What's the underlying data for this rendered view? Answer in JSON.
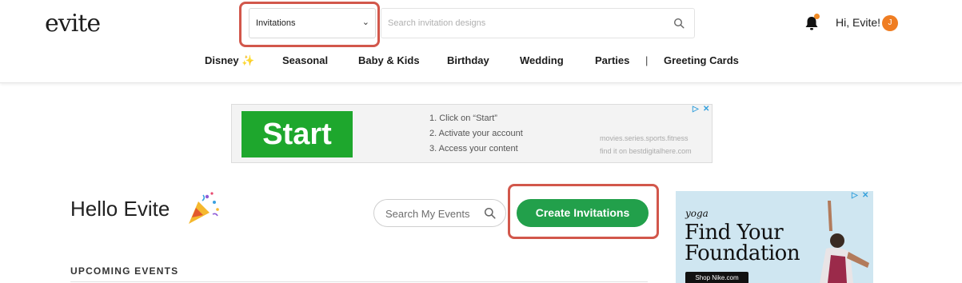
{
  "header": {
    "logo": "evite",
    "category_select": {
      "value": "Invitations"
    },
    "search": {
      "placeholder": "Search invitation designs"
    },
    "greeting": "Hi, Evite!",
    "avatar_initial": "J",
    "nav": [
      {
        "label": "Disney ✨"
      },
      {
        "label": "Seasonal"
      },
      {
        "label": "Baby & Kids"
      },
      {
        "label": "Birthday"
      },
      {
        "label": "Wedding"
      },
      {
        "label": "Parties"
      },
      {
        "label": "Greeting Cards"
      }
    ],
    "nav_separator": "|"
  },
  "top_ad": {
    "button": "Start",
    "steps": [
      "1. Click on “Start”",
      "2. Activate your account",
      "3. Access your content"
    ],
    "small_lines": [
      "movies.series.sports.fitness",
      "find it on bestdigitalhere.com"
    ]
  },
  "main": {
    "title": "Hello Evite",
    "search_events": {
      "placeholder": "Search My Events"
    },
    "create_button": "Create Invitations",
    "upcoming_label": "UPCOMING EVENTS"
  },
  "side_ad": {
    "brand": "yoga",
    "headline_1": "Find Your",
    "headline_2": "Foundation",
    "cta": "Shop Nike.com"
  },
  "colors": {
    "highlight": "#d2574b",
    "create_green": "#22a04b",
    "avatar_orange": "#ef7d22",
    "ad_green": "#1ea72d"
  }
}
